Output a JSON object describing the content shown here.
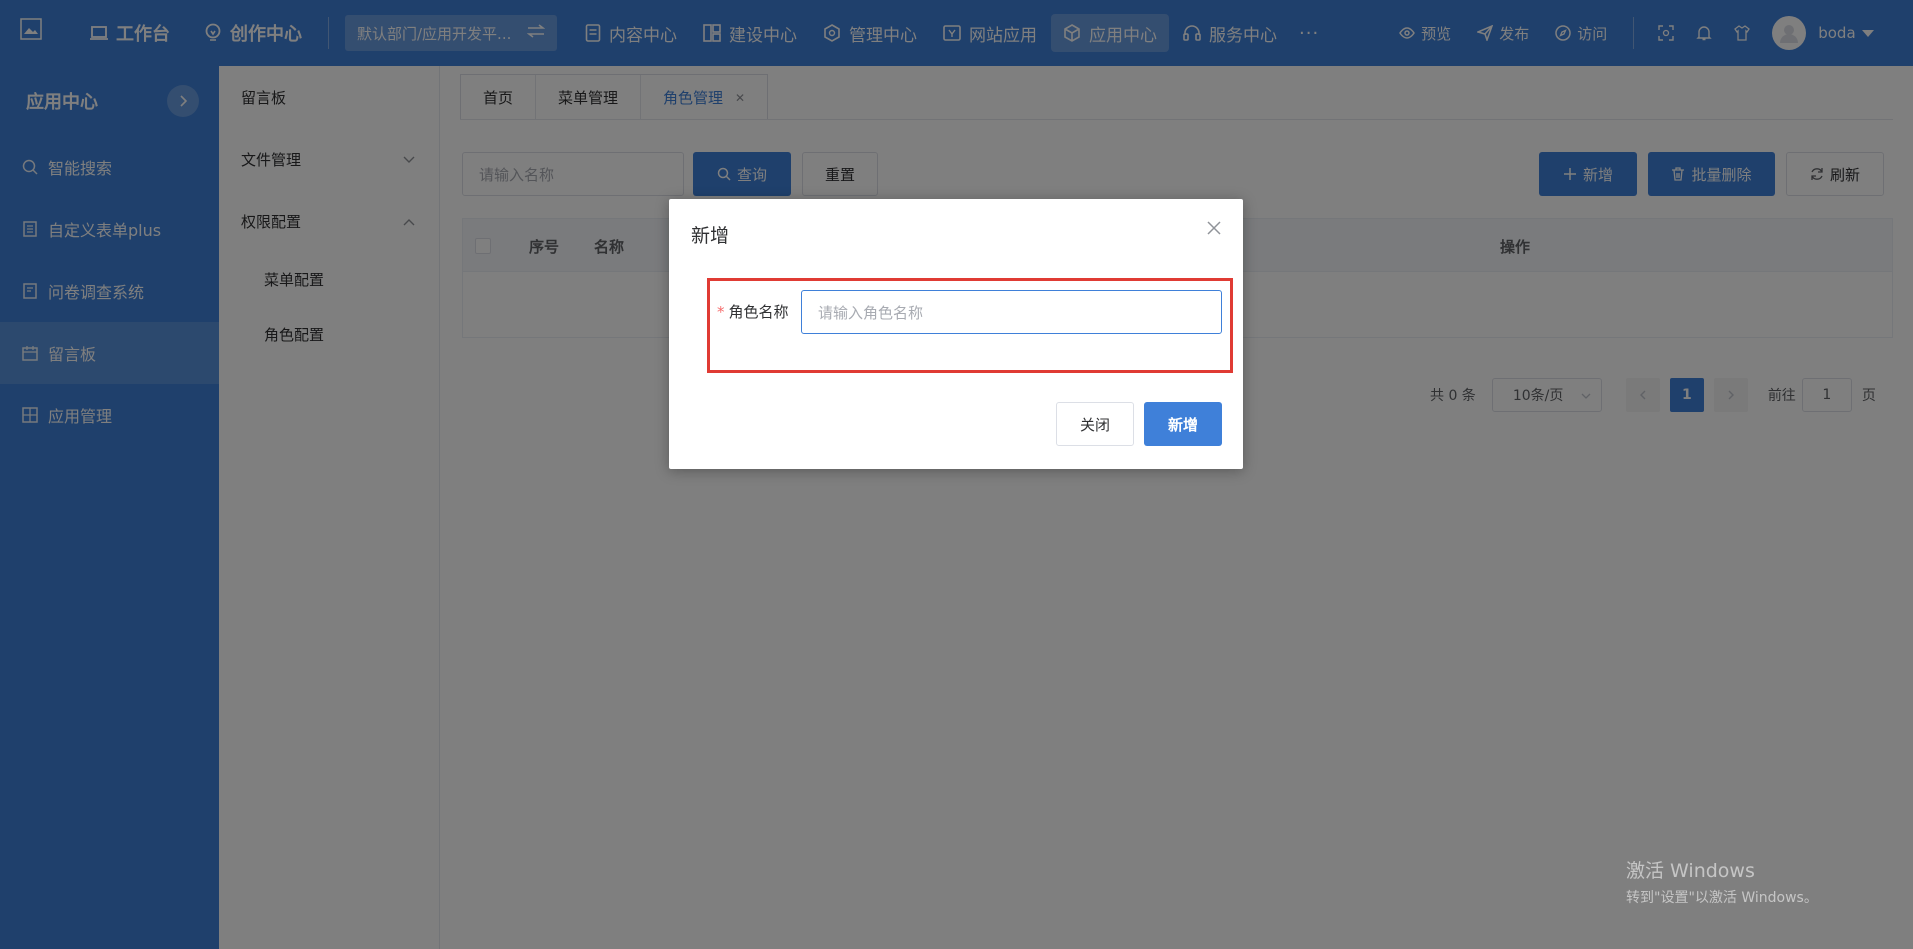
{
  "topbar": {
    "workbench": "工作台",
    "creation": "创作中心",
    "department": "默认部门/应用开发平...",
    "nav": [
      {
        "label": "内容中心",
        "icon": "document-icon"
      },
      {
        "label": "建设中心",
        "icon": "layout-icon"
      },
      {
        "label": "管理中心",
        "icon": "hexagon-icon"
      },
      {
        "label": "网站应用",
        "icon": "website-icon"
      },
      {
        "label": "应用中心",
        "icon": "cube-icon",
        "active": true
      },
      {
        "label": "服务中心",
        "icon": "headset-icon"
      }
    ],
    "more": "···",
    "actions": {
      "preview": "预览",
      "publish": "发布",
      "visit": "访问"
    },
    "username": "boda"
  },
  "sidebar": {
    "title": "应用中心",
    "items": [
      {
        "label": "智能搜索",
        "icon": "search-icon"
      },
      {
        "label": "自定义表单plus",
        "icon": "form-icon"
      },
      {
        "label": "问卷调查系统",
        "icon": "survey-icon"
      },
      {
        "label": "留言板",
        "icon": "message-board-icon",
        "active": true
      },
      {
        "label": "应用管理",
        "icon": "grid-icon"
      }
    ]
  },
  "submenu": {
    "items": [
      {
        "label": "留言板"
      },
      {
        "label": "文件管理"
      },
      {
        "label": "权限配置"
      }
    ],
    "children": [
      {
        "label": "菜单配置"
      },
      {
        "label": "角色配置"
      }
    ]
  },
  "tabs": [
    {
      "label": "首页"
    },
    {
      "label": "菜单管理"
    },
    {
      "label": "角色管理",
      "active": true
    }
  ],
  "toolbar": {
    "search_placeholder": "请输入名称",
    "query": "查询",
    "reset": "重置",
    "add": "新增",
    "batch_delete": "批量删除",
    "refresh": "刷新"
  },
  "table": {
    "columns": [
      "序号",
      "名称",
      "操作"
    ]
  },
  "pagination": {
    "total": "共 0 条",
    "page_size": "10条/页",
    "current": "1",
    "goto_label": "前往",
    "goto_value": "1",
    "page_unit": "页"
  },
  "dialog": {
    "title": "新增",
    "required_mark": "*",
    "field_label": "角色名称",
    "field_placeholder": "请输入角色名称",
    "cancel": "关闭",
    "confirm": "新增"
  },
  "watermark": {
    "line1": "激活 Windows",
    "line2": "转到\"设置\"以激活 Windows。"
  }
}
